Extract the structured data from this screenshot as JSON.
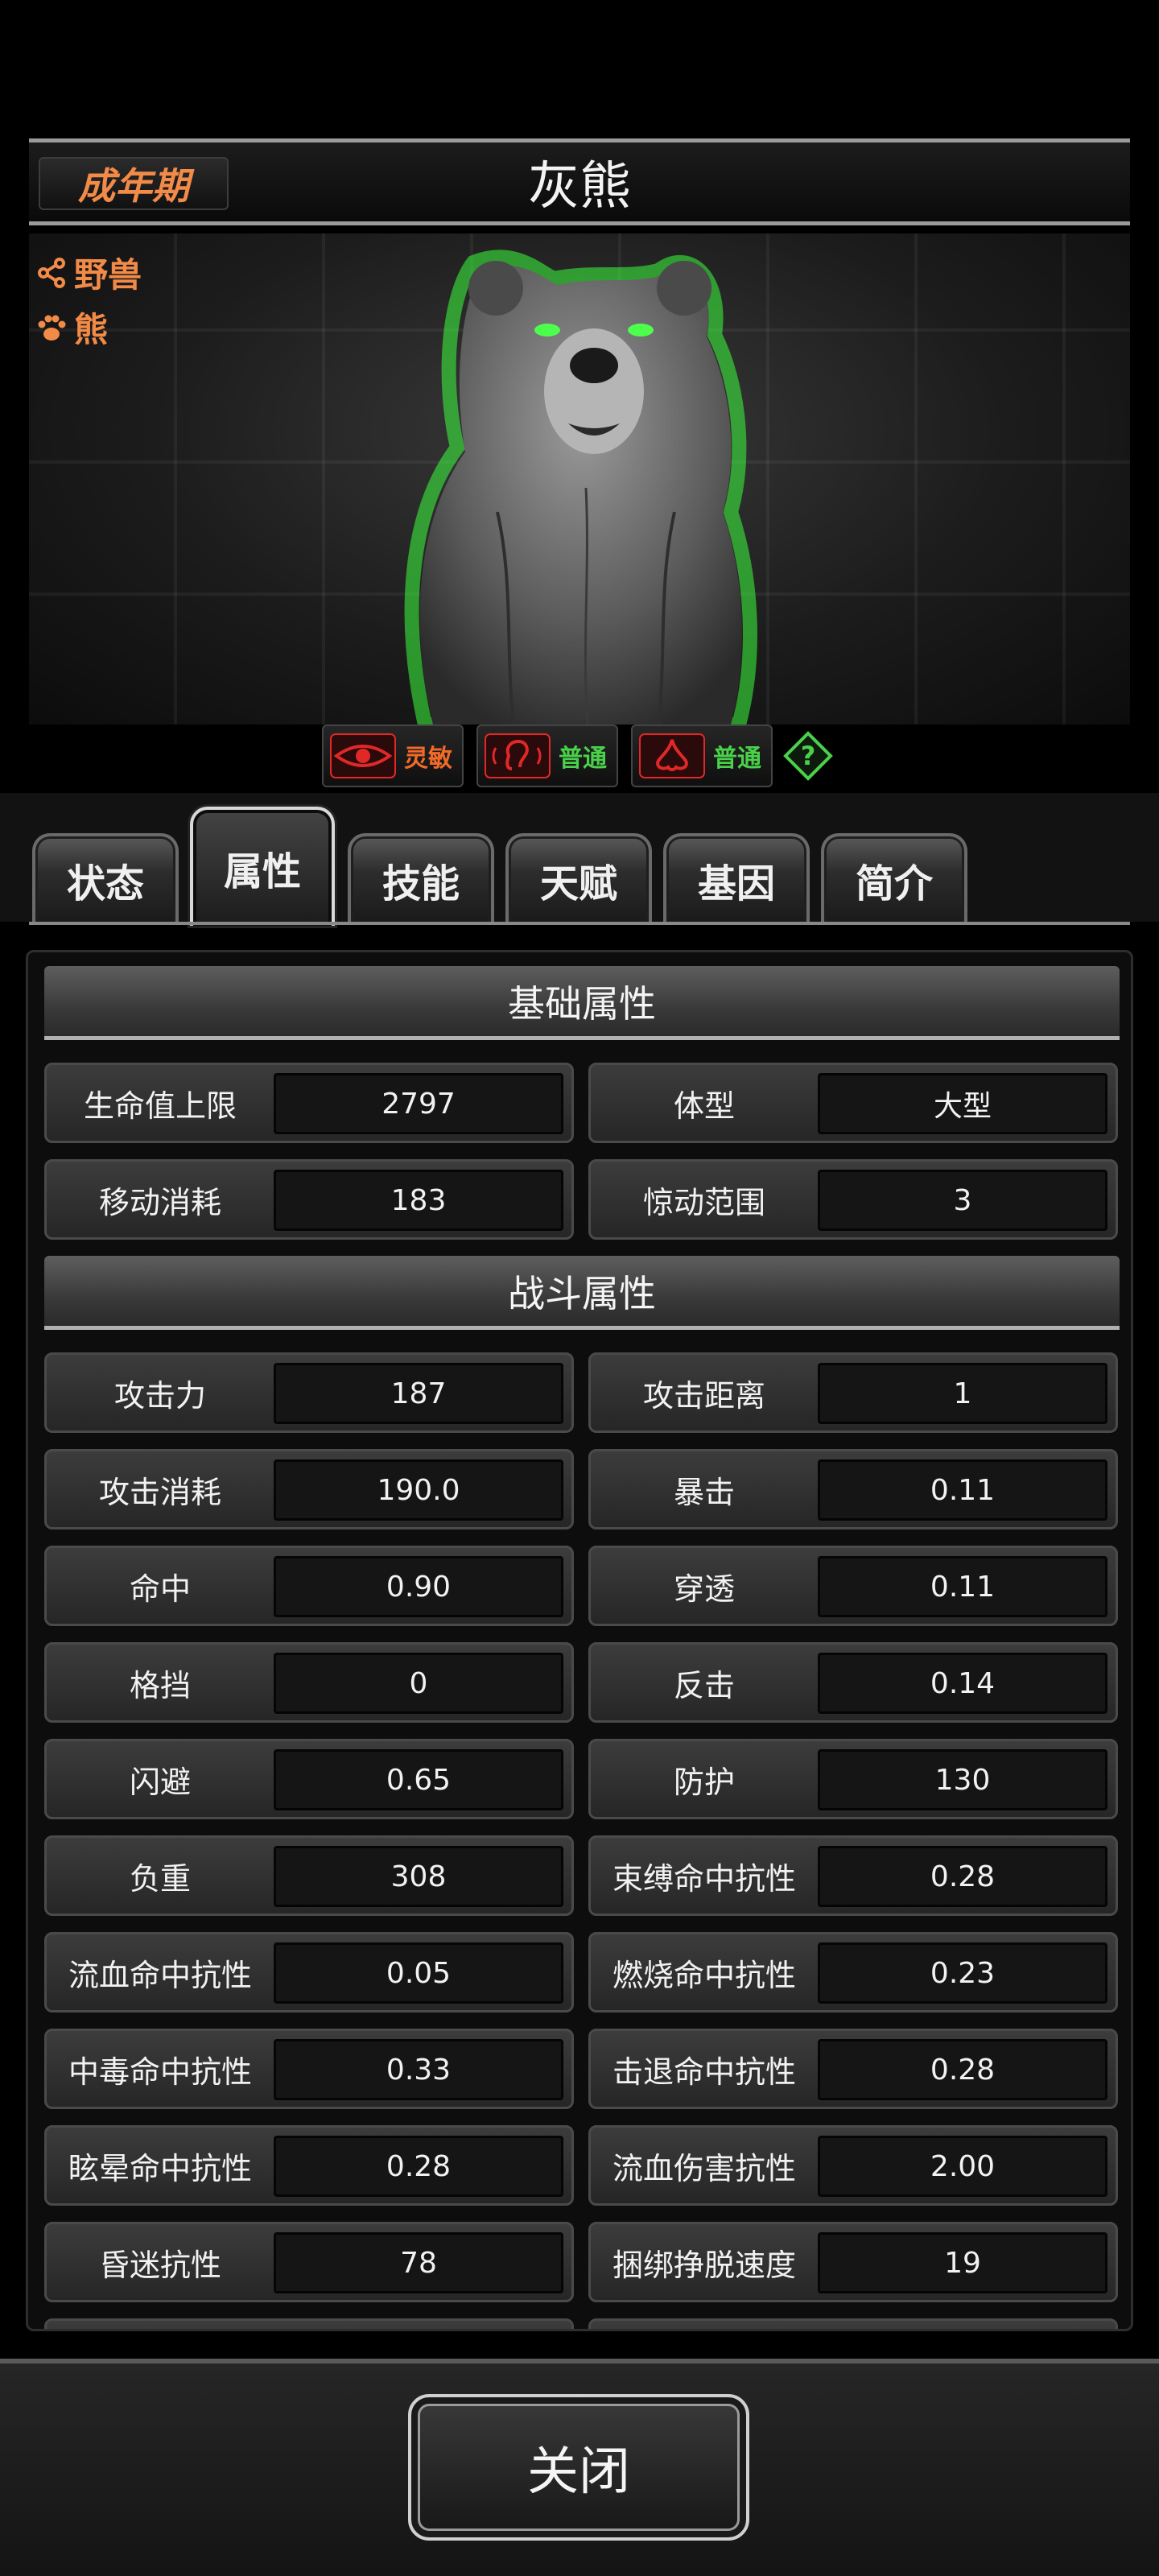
{
  "header": {
    "stage": "成年期",
    "name": "灰熊"
  },
  "tags": [
    {
      "icon": "share-icon",
      "label": "野兽"
    },
    {
      "icon": "paw-icon",
      "label": "熊"
    }
  ],
  "senses": [
    {
      "icon": "eye-icon",
      "label": "灵敏"
    },
    {
      "icon": "ear-icon",
      "label": "普通"
    },
    {
      "icon": "nose-icon",
      "label": "普通"
    }
  ],
  "tabs": [
    "状态",
    "属性",
    "技能",
    "天赋",
    "基因",
    "简介"
  ],
  "active_tab": "属性",
  "sections": {
    "basic": "基础属性",
    "combat": "战斗属性"
  },
  "basic_stats": [
    {
      "label": "生命值上限",
      "value": "2797"
    },
    {
      "label": "体型",
      "value": "大型"
    },
    {
      "label": "移动消耗",
      "value": "183"
    },
    {
      "label": "惊动范围",
      "value": "3"
    }
  ],
  "combat_stats": [
    {
      "label": "攻击力",
      "value": "187"
    },
    {
      "label": "攻击距离",
      "value": "1"
    },
    {
      "label": "攻击消耗",
      "value": "190.0"
    },
    {
      "label": "暴击",
      "value": "0.11"
    },
    {
      "label": "命中",
      "value": "0.90"
    },
    {
      "label": "穿透",
      "value": "0.11"
    },
    {
      "label": "格挡",
      "value": "0"
    },
    {
      "label": "反击",
      "value": "0.14"
    },
    {
      "label": "闪避",
      "value": "0.65"
    },
    {
      "label": "防护",
      "value": "130"
    },
    {
      "label": "负重",
      "value": "308"
    },
    {
      "label": "束缚命中抗性",
      "value": "0.28"
    },
    {
      "label": "流血命中抗性",
      "value": "0.05"
    },
    {
      "label": "燃烧命中抗性",
      "value": "0.23"
    },
    {
      "label": "中毒命中抗性",
      "value": "0.33"
    },
    {
      "label": "击退命中抗性",
      "value": "0.28"
    },
    {
      "label": "眩晕命中抗性",
      "value": "0.28"
    },
    {
      "label": "流血伤害抗性",
      "value": "2.00"
    },
    {
      "label": "昏迷抗性",
      "value": "78"
    },
    {
      "label": "捆绑挣脱速度",
      "value": "19"
    }
  ],
  "footer": {
    "close_label": "关闭"
  },
  "colors": {
    "accent_orange": "#f28a48",
    "sense_green": "#4ad14a",
    "sense_red": "#e02828"
  }
}
